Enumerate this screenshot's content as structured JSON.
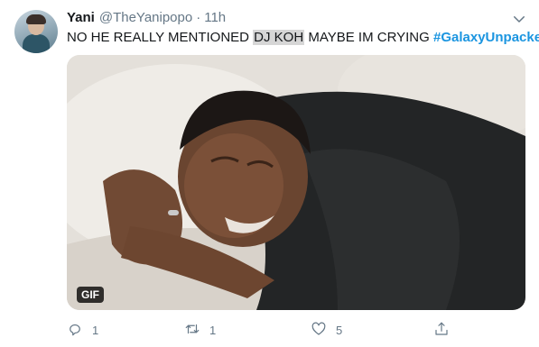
{
  "tweet": {
    "author_name": "Yani",
    "handle": "@TheYanipopo",
    "separator": "·",
    "time": "11h",
    "text_before": "NO HE REALLY MENTIONED ",
    "text_highlight": "DJ KOH",
    "text_after": " MAYBE IM CRYING ",
    "hashtag": "#GalaxyUnpacked",
    "media_badge": "GIF"
  },
  "actions": {
    "reply_count": "1",
    "retweet_count": "1",
    "like_count": "5"
  },
  "icons": {
    "more": "chevron-down-icon",
    "reply": "reply-icon",
    "retweet": "retweet-icon",
    "like": "heart-icon",
    "share": "share-icon"
  },
  "colors": {
    "hashtag": "#1b95e0",
    "secondary_text": "#657786",
    "primary_text": "#14171a"
  }
}
